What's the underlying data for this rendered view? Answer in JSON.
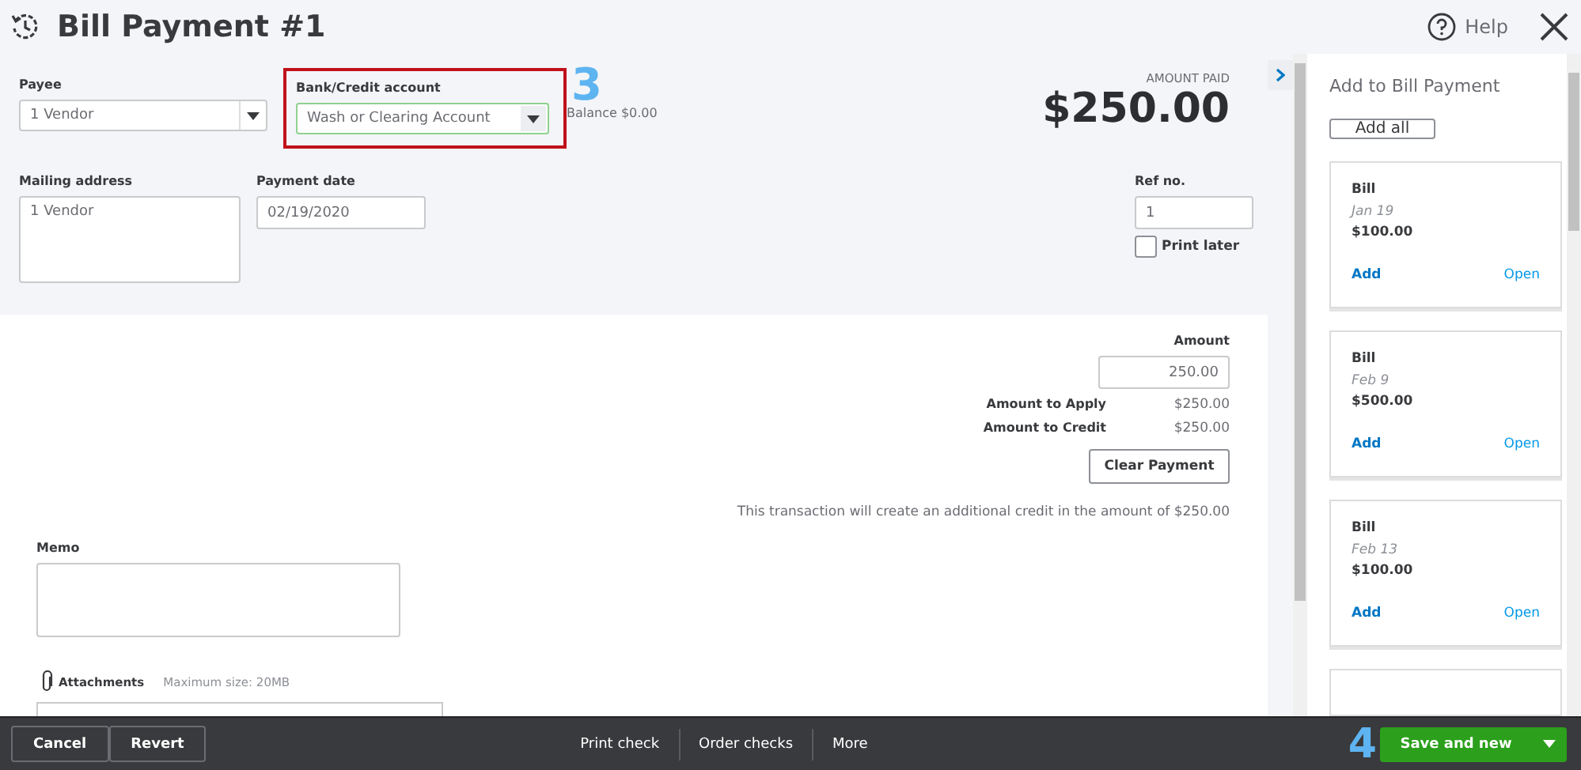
{
  "header": {
    "title": "Bill Payment #1",
    "help": "Help"
  },
  "form": {
    "payee": {
      "label": "Payee",
      "value": "1 Vendor"
    },
    "bank_account": {
      "label": "Bank/Credit account",
      "value": "Wash or Clearing Account",
      "highlighted": true
    },
    "step_marker": "3",
    "balance": "Balance $0.00",
    "amount_paid": {
      "label": "AMOUNT PAID",
      "value": "$250.00"
    },
    "mailing_address": {
      "label": "Mailing address",
      "value": "1 Vendor"
    },
    "payment_date": {
      "label": "Payment date",
      "value": "02/19/2020"
    },
    "ref_no": {
      "label": "Ref no.",
      "value": "1"
    },
    "print_later": {
      "label": "Print later",
      "checked": false
    }
  },
  "payment": {
    "amount_label": "Amount",
    "amount_value": "250.00",
    "rows": [
      {
        "label": "Amount to Apply",
        "value": "$250.00"
      },
      {
        "label": "Amount to Credit",
        "value": "$250.00"
      }
    ],
    "clear_button": "Clear Payment",
    "message": "This transaction will create an additional credit in the amount of $250.00"
  },
  "memo": {
    "label": "Memo"
  },
  "attachments": {
    "label": "Attachments",
    "hint": "Maximum size: 20MB"
  },
  "panel": {
    "title": "Add to Bill Payment",
    "add_all": "Add all",
    "bills": [
      {
        "type": "Bill",
        "date": "Jan 19",
        "amount": "$100.00",
        "add": "Add",
        "open": "Open"
      },
      {
        "type": "Bill",
        "date": "Feb 9",
        "amount": "$500.00",
        "add": "Add",
        "open": "Open"
      },
      {
        "type": "Bill",
        "date": "Feb 13",
        "amount": "$100.00",
        "add": "Add",
        "open": "Open"
      }
    ]
  },
  "footer": {
    "cancel": "Cancel",
    "revert": "Revert",
    "print_check": "Print check",
    "order_checks": "Order checks",
    "more": "More",
    "save": "Save and new",
    "step_marker": "4"
  }
}
